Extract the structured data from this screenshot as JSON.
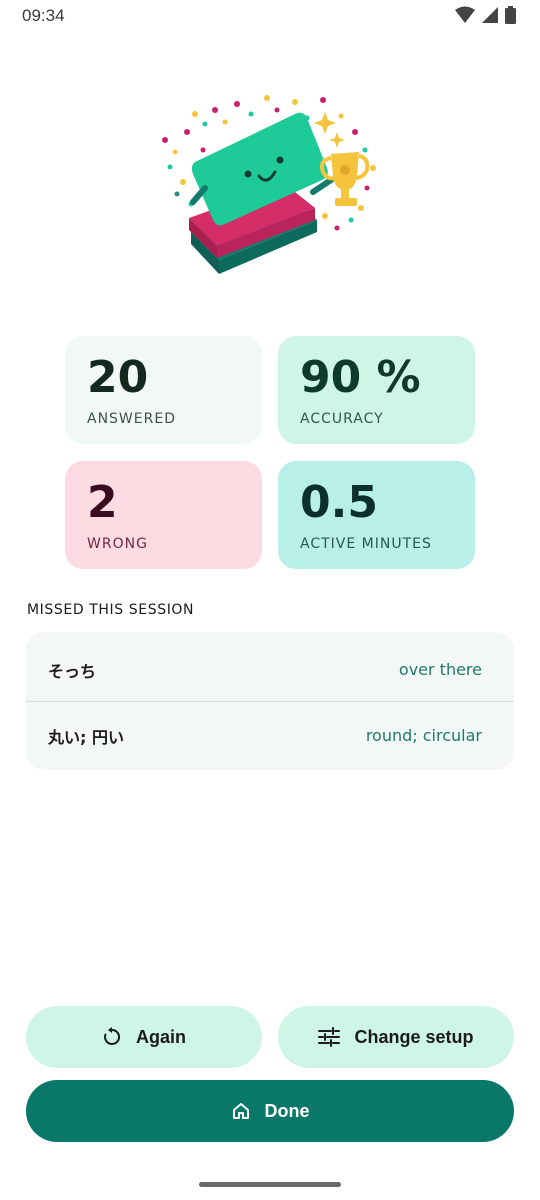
{
  "status_bar": {
    "time": "09:34"
  },
  "stats": {
    "answered": {
      "value": "20",
      "label": "ANSWERED"
    },
    "accuracy": {
      "value": "90 %",
      "label": "ACCURACY"
    },
    "wrong": {
      "value": "2",
      "label": "WRONG"
    },
    "active_minutes": {
      "value": "0.5",
      "label": "ACTIVE MINUTES"
    }
  },
  "missed": {
    "title": "MISSED THIS SESSION",
    "items": [
      {
        "term": "そっち",
        "meaning": "over there"
      },
      {
        "term": "丸い; 円い",
        "meaning": "round; circular"
      }
    ]
  },
  "actions": {
    "again_label": "Again",
    "change_setup_label": "Change setup",
    "done_label": "Done"
  },
  "colors": {
    "primary": "#0a7868",
    "tonal": "#cef5e5",
    "answered_bg": "#f1f8f5",
    "accuracy_bg": "#cef5e5",
    "wrong_bg": "#fddbe3",
    "minutes_bg": "#b8efe8"
  }
}
